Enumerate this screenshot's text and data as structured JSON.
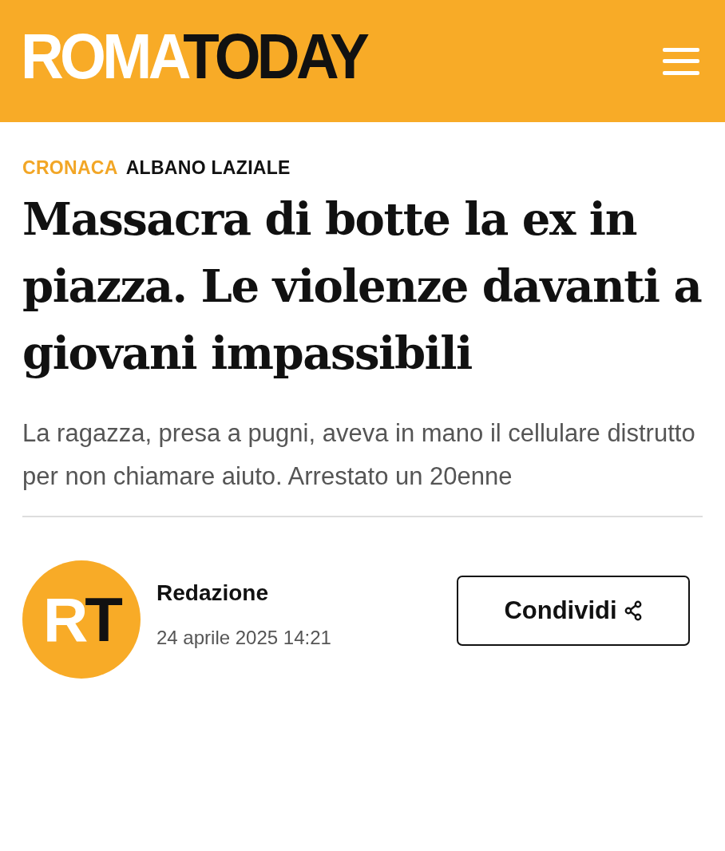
{
  "header": {
    "logo": [
      {
        "text": "ROMA",
        "kind": "light"
      },
      {
        "text": "TODAY",
        "kind": "dark"
      }
    ]
  },
  "breadcrumb": [
    {
      "text": "CRONACA",
      "kind": "section"
    },
    {
      "text": "ALBANO LAZIALE",
      "kind": "place"
    }
  ],
  "headline": "Massacra di botte la ex in piazza. Le violenze davanti a giovani impassibili",
  "summary": "La ragazza, presa a pugni, aveva in mano il cellulare distrutto per non chiamare aiuto. Arrestato un 20enne",
  "author": {
    "avatar": [
      {
        "text": "R",
        "kind": "light"
      },
      {
        "text": "T",
        "kind": "dark"
      }
    ],
    "name": "Redazione",
    "date": "24 aprile 2025 14:21"
  },
  "share_button": {
    "label": "Condividi"
  }
}
